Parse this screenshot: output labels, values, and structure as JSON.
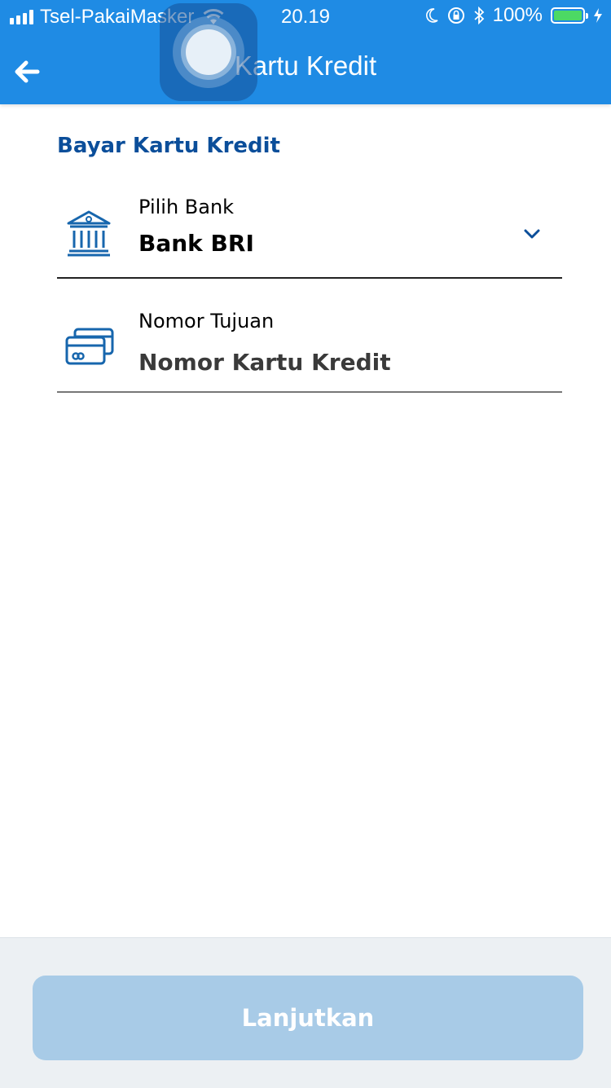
{
  "status_bar": {
    "carrier": "Tsel-PakaiMasker",
    "time": "20.19",
    "battery": "100%",
    "icons": [
      "signal-icon",
      "wifi-icon",
      "moon-icon",
      "rotation-lock-icon",
      "bluetooth-icon",
      "battery-icon",
      "charging-icon"
    ]
  },
  "header": {
    "title": "Kartu Kredit",
    "back_icon": "arrow-left-icon"
  },
  "main": {
    "section_title": "Bayar Kartu Kredit",
    "bank_field": {
      "label": "Pilih Bank",
      "value": "Bank BRI",
      "icon": "bank-icon",
      "dropdown_icon": "chevron-down-icon"
    },
    "number_field": {
      "label": "Nomor Tujuan",
      "placeholder": "Nomor Kartu Kredit",
      "value": "",
      "icon": "credit-card-icon"
    }
  },
  "footer": {
    "continue_label": "Lanjutkan",
    "continue_enabled": false
  },
  "colors": {
    "primary": "#1f8be4",
    "title_blue": "#0b4e9a",
    "icon_blue": "#1766ad",
    "button_disabled": "#a8cbe7",
    "footer_bg": "#ecf0f3",
    "battery_green": "#4cd964"
  }
}
